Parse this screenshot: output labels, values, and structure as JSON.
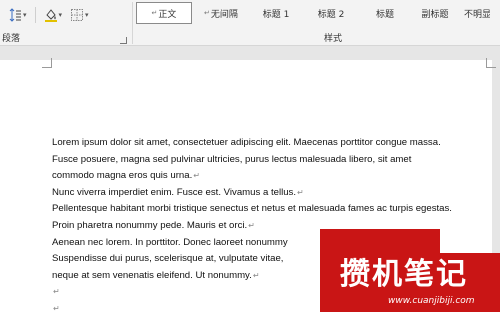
{
  "ribbon": {
    "tools": [
      "line-spacing-icon",
      "shading-icon",
      "borders-icon"
    ],
    "paragraph_group_label": "段落",
    "styles_group_label": "样式",
    "styles": [
      {
        "label": "正文",
        "marker": "↵",
        "selected": true
      },
      {
        "label": "无间隔",
        "marker": "↵",
        "selected": false
      },
      {
        "label": "标题 1",
        "marker": "",
        "selected": false
      },
      {
        "label": "标题 2",
        "marker": "",
        "selected": false
      },
      {
        "label": "标题",
        "marker": "",
        "selected": false
      },
      {
        "label": "副标题",
        "marker": "",
        "selected": false
      },
      {
        "label": "不明显",
        "marker": "",
        "selected": false
      }
    ]
  },
  "document": {
    "return_mark": "↵",
    "lines": [
      {
        "text": "Lorem ipsum dolor sit amet, consectetuer adipiscing elit. Maecenas porttitor congue massa.",
        "justify": true,
        "mark": false
      },
      {
        "text": "Fusce posuere, magna sed pulvinar ultricies, purus lectus malesuada libero, sit amet",
        "justify": true,
        "mark": false
      },
      {
        "text": "commodo magna eros quis urna.",
        "justify": false,
        "mark": true
      },
      {
        "text": "Nunc viverra imperdiet enim. Fusce est. Vivamus a tellus.",
        "justify": false,
        "mark": true
      },
      {
        "text": "Pellentesque habitant morbi tristique senectus et netus et malesuada fames ac turpis egestas.",
        "justify": false,
        "mark": false
      },
      {
        "text": "Proin pharetra nonummy pede. Mauris et orci.",
        "justify": false,
        "mark": true
      },
      {
        "text": "Aenean nec lorem. In porttitor. Donec laoreet nonummy",
        "justify": false,
        "mark": false
      },
      {
        "text": "Suspendisse dui purus, scelerisque at, vulputate vitae,",
        "justify": false,
        "mark": false
      },
      {
        "text": "neque at sem venenatis eleifend. Ut nonummy.",
        "justify": false,
        "mark": true
      },
      {
        "text": "",
        "justify": false,
        "mark": true
      },
      {
        "text": "",
        "justify": false,
        "mark": true
      }
    ]
  },
  "watermark": {
    "title": "攒机笔记",
    "url": "www.cuanjibiji.com",
    "color": "#c91515"
  }
}
